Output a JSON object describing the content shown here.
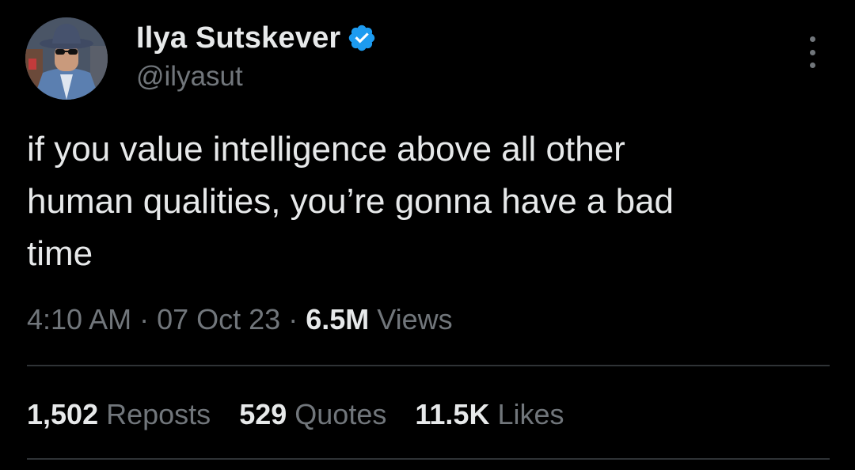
{
  "author": {
    "display_name": "Ilya Sutskever",
    "handle": "@ilyasut",
    "verified": true,
    "verified_color": "#1d9bf0"
  },
  "tweet": {
    "text": "if you value intelligence above all other\nhuman qualities, you’re gonna have a bad\ntime",
    "time": "4:10 AM",
    "date": "07 Oct 23",
    "separator": " · ",
    "views_count": "6.5M",
    "views_label": "Views"
  },
  "stats": {
    "reposts": {
      "count": "1,502",
      "label": "Reposts"
    },
    "quotes": {
      "count": "529",
      "label": "Quotes"
    },
    "likes": {
      "count": "11.5K",
      "label": "Likes"
    }
  },
  "icons": {
    "more": "more-options-icon",
    "verified": "verified-badge-icon"
  },
  "colors": {
    "background": "#000000",
    "primary_text": "#e7e9ea",
    "secondary_text": "#71767b",
    "divider": "#2f3336"
  }
}
